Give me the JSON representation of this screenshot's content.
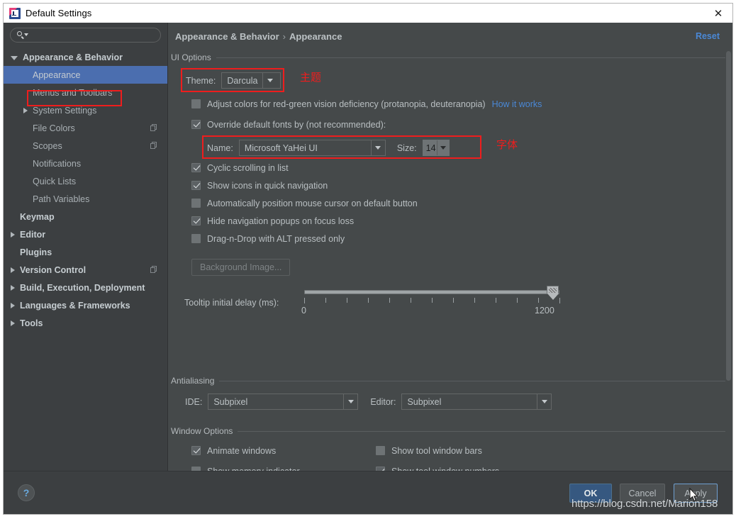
{
  "window": {
    "title": "Default Settings",
    "app_icon": "intellij-icon",
    "close_icon": "close-icon"
  },
  "sidebar": {
    "search": {
      "placeholder": "",
      "value": "",
      "icon": "search-icon"
    },
    "items": [
      {
        "label": "Appearance & Behavior",
        "level": 0,
        "arrow": "down",
        "bold": true,
        "selected": false,
        "badge": false
      },
      {
        "label": "Appearance",
        "level": 1,
        "arrow": "none",
        "bold": false,
        "selected": true,
        "badge": false
      },
      {
        "label": "Menus and Toolbars",
        "level": 1,
        "arrow": "none",
        "bold": false,
        "selected": false,
        "badge": false
      },
      {
        "label": "System Settings",
        "level": 1,
        "arrow": "right",
        "bold": false,
        "selected": false,
        "badge": false
      },
      {
        "label": "File Colors",
        "level": 1,
        "arrow": "none",
        "bold": false,
        "selected": false,
        "badge": true
      },
      {
        "label": "Scopes",
        "level": 1,
        "arrow": "none",
        "bold": false,
        "selected": false,
        "badge": true
      },
      {
        "label": "Notifications",
        "level": 1,
        "arrow": "none",
        "bold": false,
        "selected": false,
        "badge": false
      },
      {
        "label": "Quick Lists",
        "level": 1,
        "arrow": "none",
        "bold": false,
        "selected": false,
        "badge": false
      },
      {
        "label": "Path Variables",
        "level": 1,
        "arrow": "none",
        "bold": false,
        "selected": false,
        "badge": false
      },
      {
        "label": "Keymap",
        "level": 0,
        "arrow": "none",
        "bold": true,
        "selected": false,
        "badge": false
      },
      {
        "label": "Editor",
        "level": 0,
        "arrow": "right",
        "bold": true,
        "selected": false,
        "badge": false
      },
      {
        "label": "Plugins",
        "level": 0,
        "arrow": "none",
        "bold": true,
        "selected": false,
        "badge": false
      },
      {
        "label": "Version Control",
        "level": 0,
        "arrow": "right",
        "bold": true,
        "selected": false,
        "badge": true
      },
      {
        "label": "Build, Execution, Deployment",
        "level": 0,
        "arrow": "right",
        "bold": true,
        "selected": false,
        "badge": false
      },
      {
        "label": "Languages & Frameworks",
        "level": 0,
        "arrow": "right",
        "bold": true,
        "selected": false,
        "badge": false
      },
      {
        "label": "Tools",
        "level": 0,
        "arrow": "right",
        "bold": true,
        "selected": false,
        "badge": false
      }
    ]
  },
  "main": {
    "breadcrumb_root": "Appearance & Behavior",
    "breadcrumb_sep": "›",
    "breadcrumb_leaf": "Appearance",
    "reset_label": "Reset",
    "ui_options": {
      "title": "UI Options",
      "theme_label": "Theme:",
      "theme_value": "Darcula",
      "adjust_colors_label": "Adjust colors for red-green vision deficiency (protanopia, deuteranopia)",
      "adjust_colors_checked": false,
      "how_it_works_label": "How it works",
      "override_fonts_label": "Override default fonts by (not recommended):",
      "override_fonts_checked": true,
      "font_name_label": "Name:",
      "font_name_value": "Microsoft YaHei UI",
      "font_size_label": "Size:",
      "font_size_value": "14",
      "checkboxes": [
        {
          "label": "Cyclic scrolling in list",
          "checked": true
        },
        {
          "label": "Show icons in quick navigation",
          "checked": true
        },
        {
          "label": "Automatically position mouse cursor on default button",
          "checked": false
        },
        {
          "label": "Hide navigation popups on focus loss",
          "checked": true
        },
        {
          "label": "Drag-n-Drop with ALT pressed only",
          "checked": false
        }
      ],
      "background_image_label": "Background Image...",
      "tooltip_delay_label": "Tooltip initial delay (ms):",
      "tooltip_delay_min": "0",
      "tooltip_delay_max": "1200"
    },
    "antialiasing": {
      "title": "Antialiasing",
      "ide_label": "IDE:",
      "ide_value": "Subpixel",
      "editor_label": "Editor:",
      "editor_value": "Subpixel"
    },
    "window_options": {
      "title": "Window Options",
      "left": [
        {
          "label": "Animate windows",
          "checked": true
        },
        {
          "label": "Show memory indicator",
          "checked": false
        }
      ],
      "right": [
        {
          "label": "Show tool window bars",
          "checked": false
        },
        {
          "label": "Show tool window numbers",
          "checked": true
        }
      ]
    }
  },
  "annotations": {
    "theme_note": "主题",
    "font_note": "字体",
    "box_color": "#ef1d1d"
  },
  "footer": {
    "help_label": "?",
    "ok_label": "OK",
    "cancel_label": "Cancel",
    "apply_label": "Apply"
  },
  "watermark": "https://blog.csdn.net/Marion158"
}
